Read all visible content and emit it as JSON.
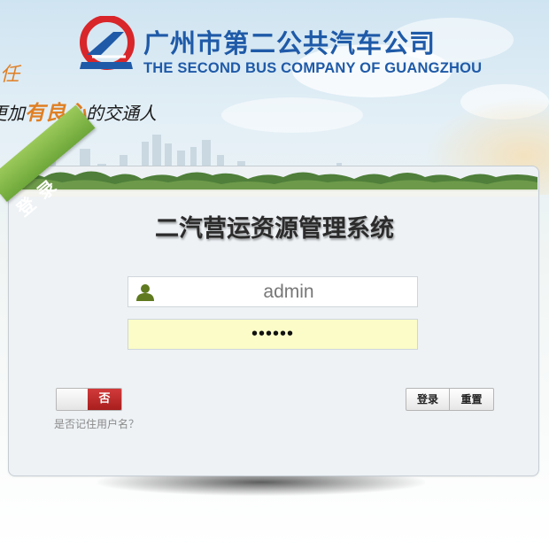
{
  "brand": {
    "name_cn": "广州市第二公共汽车公司",
    "name_en": "THE SECOND BUS COMPANY OF GUANGZHOU",
    "logo_colors": {
      "red": "#d8262a",
      "blue": "#1f5aa8"
    }
  },
  "slogan": {
    "line1": "任",
    "line2_prefix": "更加",
    "line2_highlight": "有良心",
    "line2_suffix": "的交通人"
  },
  "ribbon": {
    "label": "登录"
  },
  "system_title": "二汽营运资源管理系统",
  "form": {
    "username": {
      "value": "admin",
      "icon": "user-icon"
    },
    "password": {
      "value": "••••••"
    },
    "remember": {
      "toggle_label": "否",
      "description": "是否记住用户名？"
    },
    "buttons": {
      "login": "登录",
      "reset": "重置"
    }
  },
  "colors": {
    "accent_green": "#7ab446",
    "password_bg": "#fbfcc8",
    "toggle_red": "#c02d2d",
    "brand_blue": "#1f5aa8",
    "slogan_orange": "#e07f23"
  }
}
